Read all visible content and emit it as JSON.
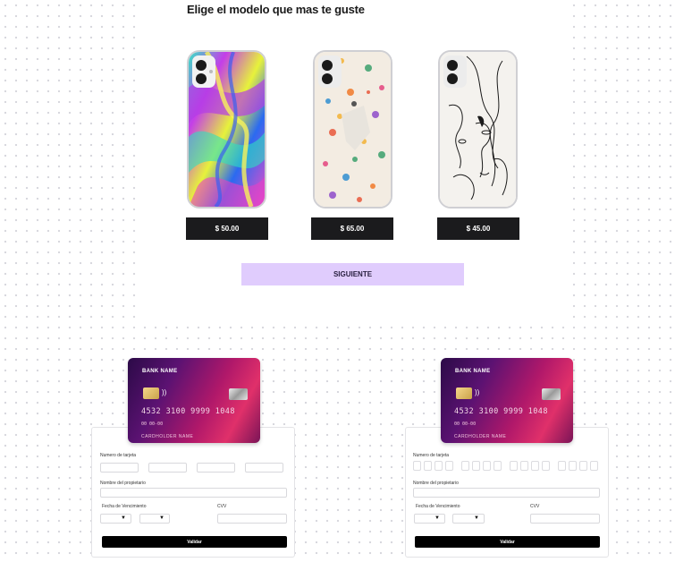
{
  "heading": "Elige el modelo que mas te guste",
  "products": [
    {
      "price": "$ 50.00",
      "design": "psychedelic-swirl"
    },
    {
      "price": "$ 65.00",
      "design": "floral-pattern"
    },
    {
      "price": "$ 45.00",
      "design": "line-art-faces"
    }
  ],
  "next_label": "SIGUIENTE",
  "card": {
    "bank": "BANK NAME",
    "number": "4532 3100 9999 1048",
    "expiry": "00   00-00",
    "holder": "CARDHOLDER NAME"
  },
  "form": {
    "card_number_label": "Numero de tarjeta",
    "owner_label": "Nombre del propietario",
    "expiry_label": "Fecha de Vencimiento",
    "cvv_label": "CVV",
    "validate_label": "Validar"
  },
  "icons": {
    "dropdown": "chevron-down-icon",
    "nfc": "contactless-icon",
    "chip": "chip-icon"
  }
}
